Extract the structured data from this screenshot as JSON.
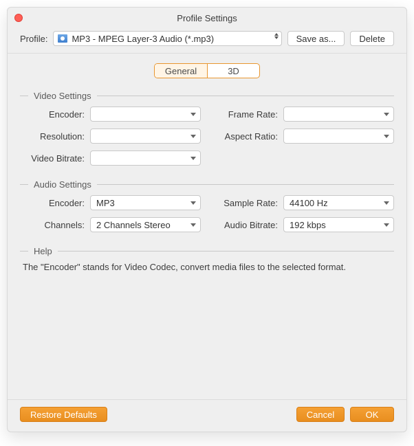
{
  "window": {
    "title": "Profile Settings"
  },
  "toprow": {
    "profile_label": "Profile:",
    "profile_value": "MP3 - MPEG Layer-3 Audio (*.mp3)",
    "save_as_label": "Save as...",
    "delete_label": "Delete"
  },
  "tabs": {
    "general": "General",
    "three_d": "3D",
    "active": "general"
  },
  "video": {
    "section_title": "Video Settings",
    "encoder_label": "Encoder:",
    "encoder_value": "",
    "resolution_label": "Resolution:",
    "resolution_value": "",
    "bitrate_label": "Video Bitrate:",
    "bitrate_value": "",
    "framerate_label": "Frame Rate:",
    "framerate_value": "",
    "aspect_label": "Aspect Ratio:",
    "aspect_value": ""
  },
  "audio": {
    "section_title": "Audio Settings",
    "encoder_label": "Encoder:",
    "encoder_value": "MP3",
    "channels_label": "Channels:",
    "channels_value": "2 Channels Stereo",
    "samplerate_label": "Sample Rate:",
    "samplerate_value": "44100 Hz",
    "bitrate_label": "Audio Bitrate:",
    "bitrate_value": "192 kbps"
  },
  "help": {
    "section_title": "Help",
    "text": "The \"Encoder\" stands for Video Codec, convert media files to the selected format."
  },
  "footer": {
    "restore_label": "Restore Defaults",
    "cancel_label": "Cancel",
    "ok_label": "OK"
  },
  "colors": {
    "accent": "#ed8e21"
  }
}
